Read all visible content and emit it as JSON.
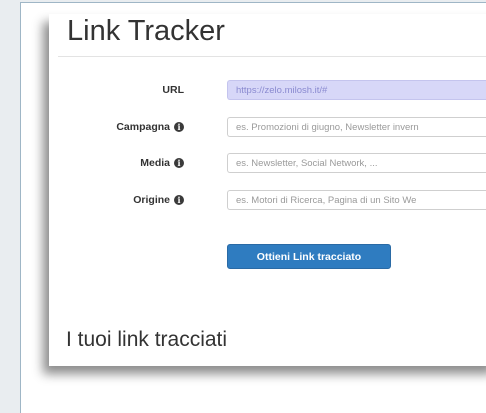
{
  "app": {
    "title": "Link Tracker"
  },
  "form": {
    "url": {
      "label": "URL",
      "value": "https://zelo.milosh.it/#"
    },
    "campagna": {
      "label": "Campagna",
      "placeholder": "es. Promozioni di giugno, Newsletter invern"
    },
    "media": {
      "label": "Media",
      "placeholder": "es. Newsletter, Social Network, ..."
    },
    "origine": {
      "label": "Origine",
      "placeholder": "es. Motori di Ricerca, Pagina di un Sito We"
    },
    "submit_label": "Ottieni Link tracciato",
    "info_glyph": "i"
  },
  "tracked_links": {
    "title": "I tuoi link tracciati"
  },
  "colors": {
    "primary": "#2f7cc0",
    "url_field_bg": "#d7d7f8",
    "page_bg": "#e9edf0"
  }
}
